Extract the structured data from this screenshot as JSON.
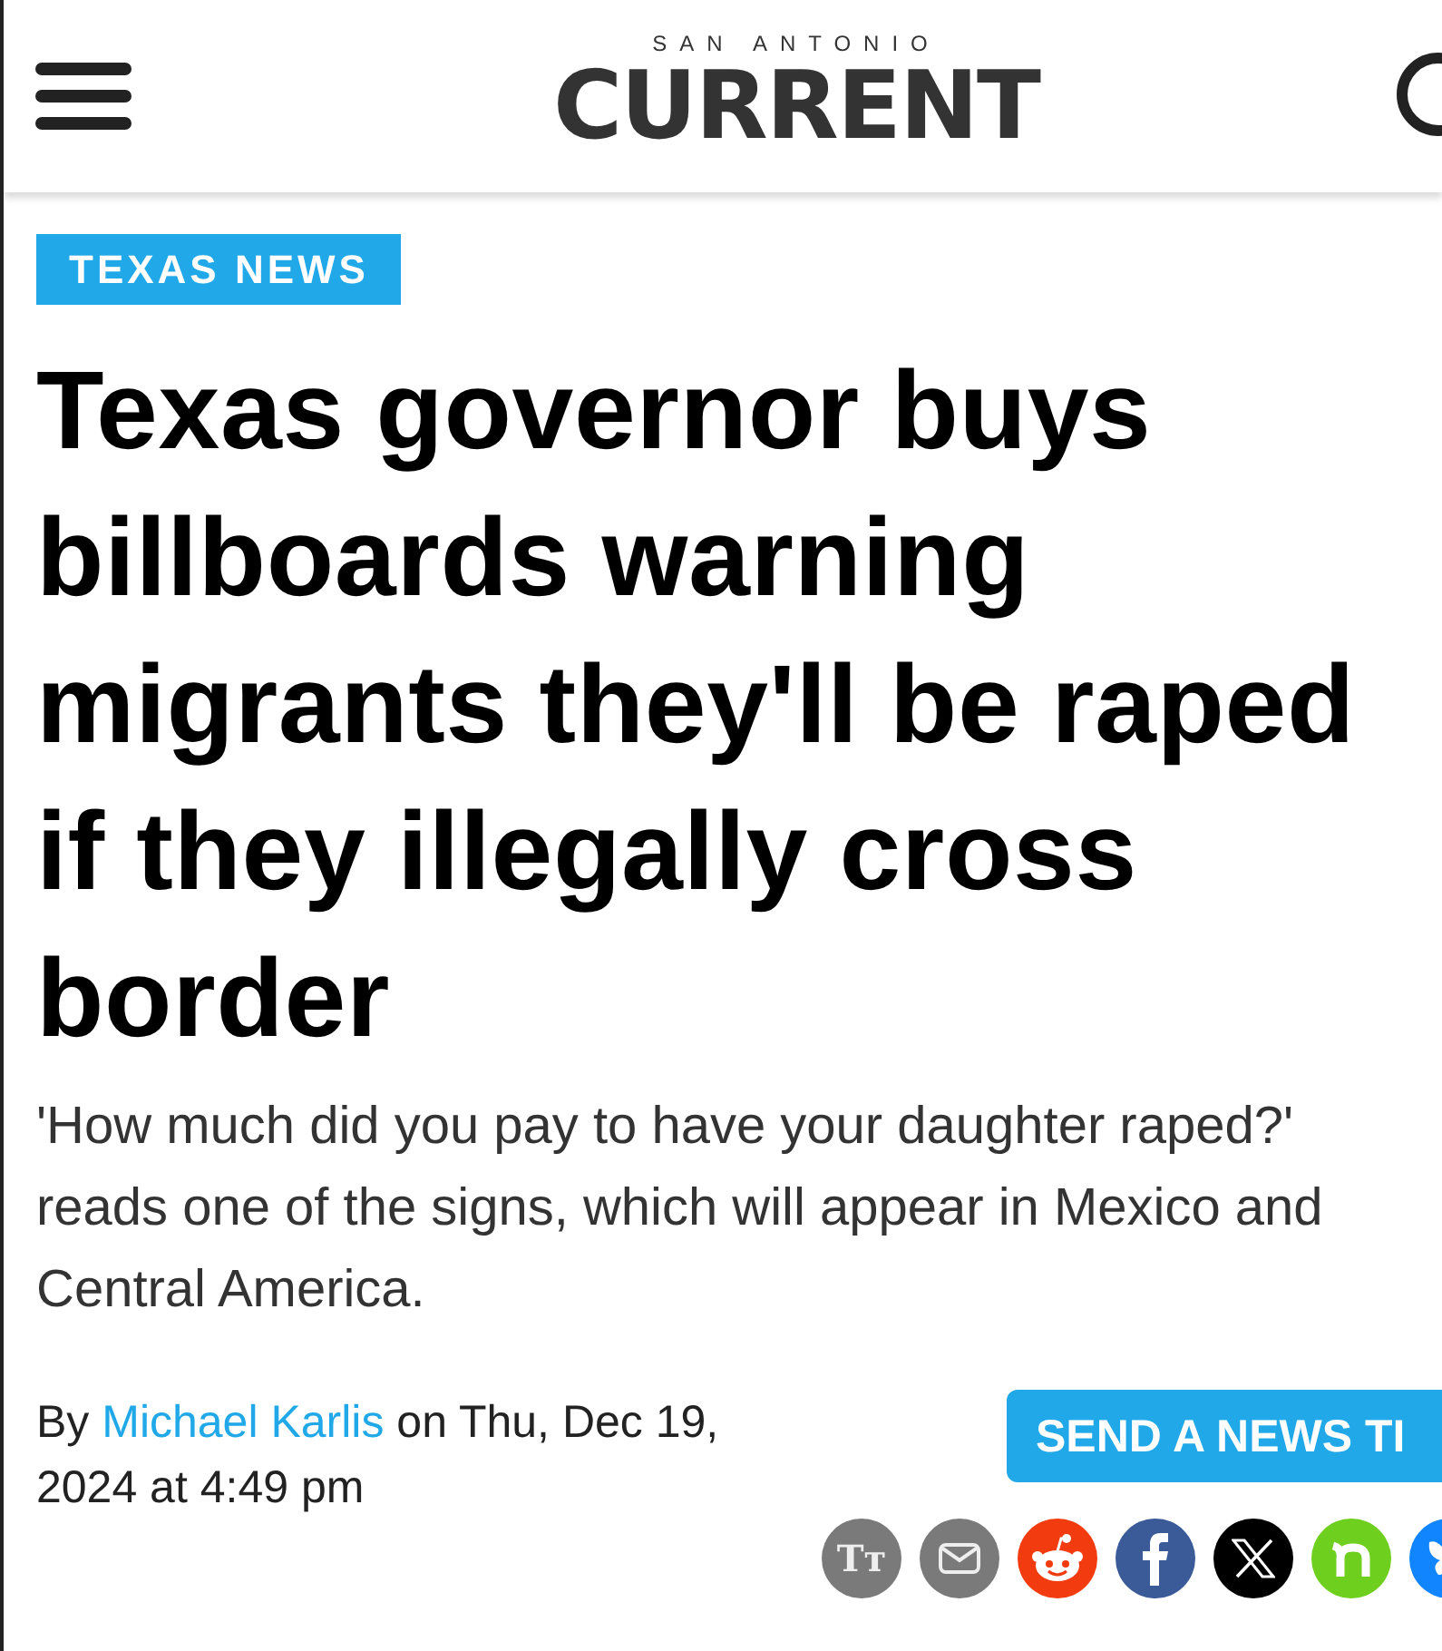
{
  "header": {
    "logo_small": "SAN ANTONIO",
    "logo_big": "CURRENT"
  },
  "article": {
    "category": "TEXAS NEWS",
    "headline": "Texas governor buys billboards warning migrants they'll be raped if they illegally cross border",
    "dek": "'How much did you pay to have your daughter raped?' reads one of the signs, which will appear in Mexico and Central America.",
    "byline": {
      "prefix": "By",
      "author": "Michael Karlis",
      "date": "on Thu, Dec 19, 2024 at 4:49 pm"
    },
    "tip_button": "SEND A NEWS TI",
    "share": [
      {
        "kind": "textsize",
        "label": "Tт"
      },
      {
        "kind": "email"
      },
      {
        "kind": "reddit"
      },
      {
        "kind": "facebook"
      },
      {
        "kind": "x"
      },
      {
        "kind": "nextdoor"
      },
      {
        "kind": "bluesky"
      }
    ]
  }
}
